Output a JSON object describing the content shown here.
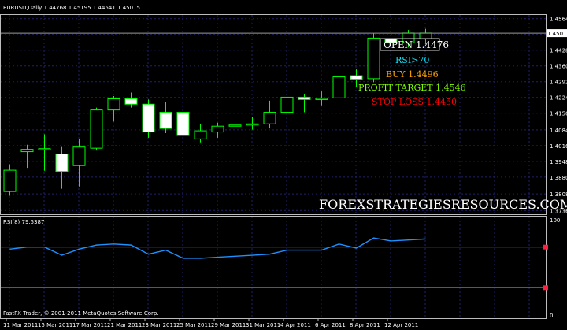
{
  "chart": {
    "symbol_header": "EURUSD,Daily  1.44768 1.45195 1.44541 1.45015",
    "current_price": "1.45015",
    "price_labels": [
      "1.4564",
      "1.4496",
      "1.4428",
      "1.4360",
      "1.4292",
      "1.4224",
      "1.4156",
      "1.4084",
      "1.4016",
      "1.3948",
      "1.3880",
      "1.3808",
      "1.3736"
    ],
    "date_labels": [
      "11 Mar 2011",
      "15 Mar 2011",
      "17 Mar 2011",
      "21 Mar 2011",
      "23 Mar 2011",
      "25 Mar 2011",
      "29 Mar 2011",
      "31 Mar 2011",
      "4 Apr 2011",
      "6 Apr 2011",
      "8 Apr 2011",
      "12 Apr 2011"
    ],
    "watermark": "FOREXSTRATEGIESRESOURCES.COM",
    "copyright": "FastFX Trader, © 2001-2011 MetaQuotes Software Corp.",
    "annotations": {
      "open": "OPEN 1.4476",
      "rsi": "RSI>70",
      "buy": "BUY 1.4496",
      "profit": "PROFIT TARGET 1.4546",
      "stop": "STOP LOSS 1.4450"
    },
    "colors": {
      "background": "#000000",
      "grid": "#1f1f6e",
      "bull_fill": "#000000",
      "bear_fill": "#ffffff",
      "candle_line": "#00ff00",
      "rsi_line": "#1e90ff",
      "level_line": "#ff1f3f",
      "open": "#ffffff",
      "rsi_text": "#00e5ff",
      "buy": "#ffa500",
      "profit": "#7fff00",
      "stop": "#ff0000"
    }
  },
  "rsi": {
    "header": "RSI(8) 79.5387",
    "max": "100",
    "min": "0",
    "levels": [
      70,
      30
    ],
    "values": [
      68,
      70,
      70,
      62,
      68,
      72,
      73,
      72,
      63,
      67,
      59,
      59,
      60,
      61,
      62,
      63,
      67,
      67,
      67,
      73,
      69,
      79,
      76,
      77,
      78
    ]
  },
  "chart_data": {
    "type": "candlestick",
    "title": "EURUSD,Daily",
    "x": [
      "10 Mar",
      "11 Mar",
      "14 Mar",
      "15 Mar",
      "16 Mar",
      "17 Mar",
      "18 Mar",
      "21 Mar",
      "22 Mar",
      "23 Mar",
      "24 Mar",
      "25 Mar",
      "28 Mar",
      "29 Mar",
      "30 Mar",
      "31 Mar",
      "1 Apr",
      "4 Apr",
      "5 Apr",
      "6 Apr",
      "7 Apr",
      "8 Apr",
      "11 Apr",
      "12 Apr",
      "13 Apr"
    ],
    "ohlc": [
      [
        1.3818,
        1.3936,
        1.38,
        1.391
      ],
      [
        1.399,
        1.402,
        1.392,
        1.4
      ],
      [
        1.4003,
        1.4065,
        1.3908,
        1.4003
      ],
      [
        1.398,
        1.401,
        1.383,
        1.3905
      ],
      [
        1.393,
        1.4045,
        1.384,
        1.401
      ],
      [
        1.4005,
        1.418,
        1.3995,
        1.417
      ],
      [
        1.417,
        1.423,
        1.412,
        1.4218
      ],
      [
        1.4218,
        1.4245,
        1.418,
        1.4195
      ],
      [
        1.4195,
        1.4215,
        1.405,
        1.4075
      ],
      [
        1.416,
        1.4205,
        1.407,
        1.409
      ],
      [
        1.416,
        1.4185,
        1.404,
        1.406
      ],
      [
        1.4045,
        1.411,
        1.403,
        1.408
      ],
      [
        1.4075,
        1.4115,
        1.405,
        1.41
      ],
      [
        1.41,
        1.4135,
        1.4065,
        1.4105
      ],
      [
        1.4105,
        1.4138,
        1.4085,
        1.411
      ],
      [
        1.411,
        1.421,
        1.409,
        1.416
      ],
      [
        1.416,
        1.4235,
        1.407,
        1.4225
      ],
      [
        1.4225,
        1.424,
        1.416,
        1.4215
      ],
      [
        1.4215,
        1.425,
        1.419,
        1.422
      ],
      [
        1.4222,
        1.4345,
        1.419,
        1.4313
      ],
      [
        1.4318,
        1.4345,
        1.427,
        1.4303
      ],
      [
        1.4305,
        1.45,
        1.429,
        1.448
      ],
      [
        1.4478,
        1.451,
        1.4425,
        1.446
      ],
      [
        1.446,
        1.4515,
        1.444,
        1.4502
      ],
      [
        1.4477,
        1.452,
        1.4454,
        1.4502
      ]
    ],
    "ylim": [
      1.372,
      1.458
    ],
    "rsi_ylim": [
      0,
      100
    ]
  }
}
